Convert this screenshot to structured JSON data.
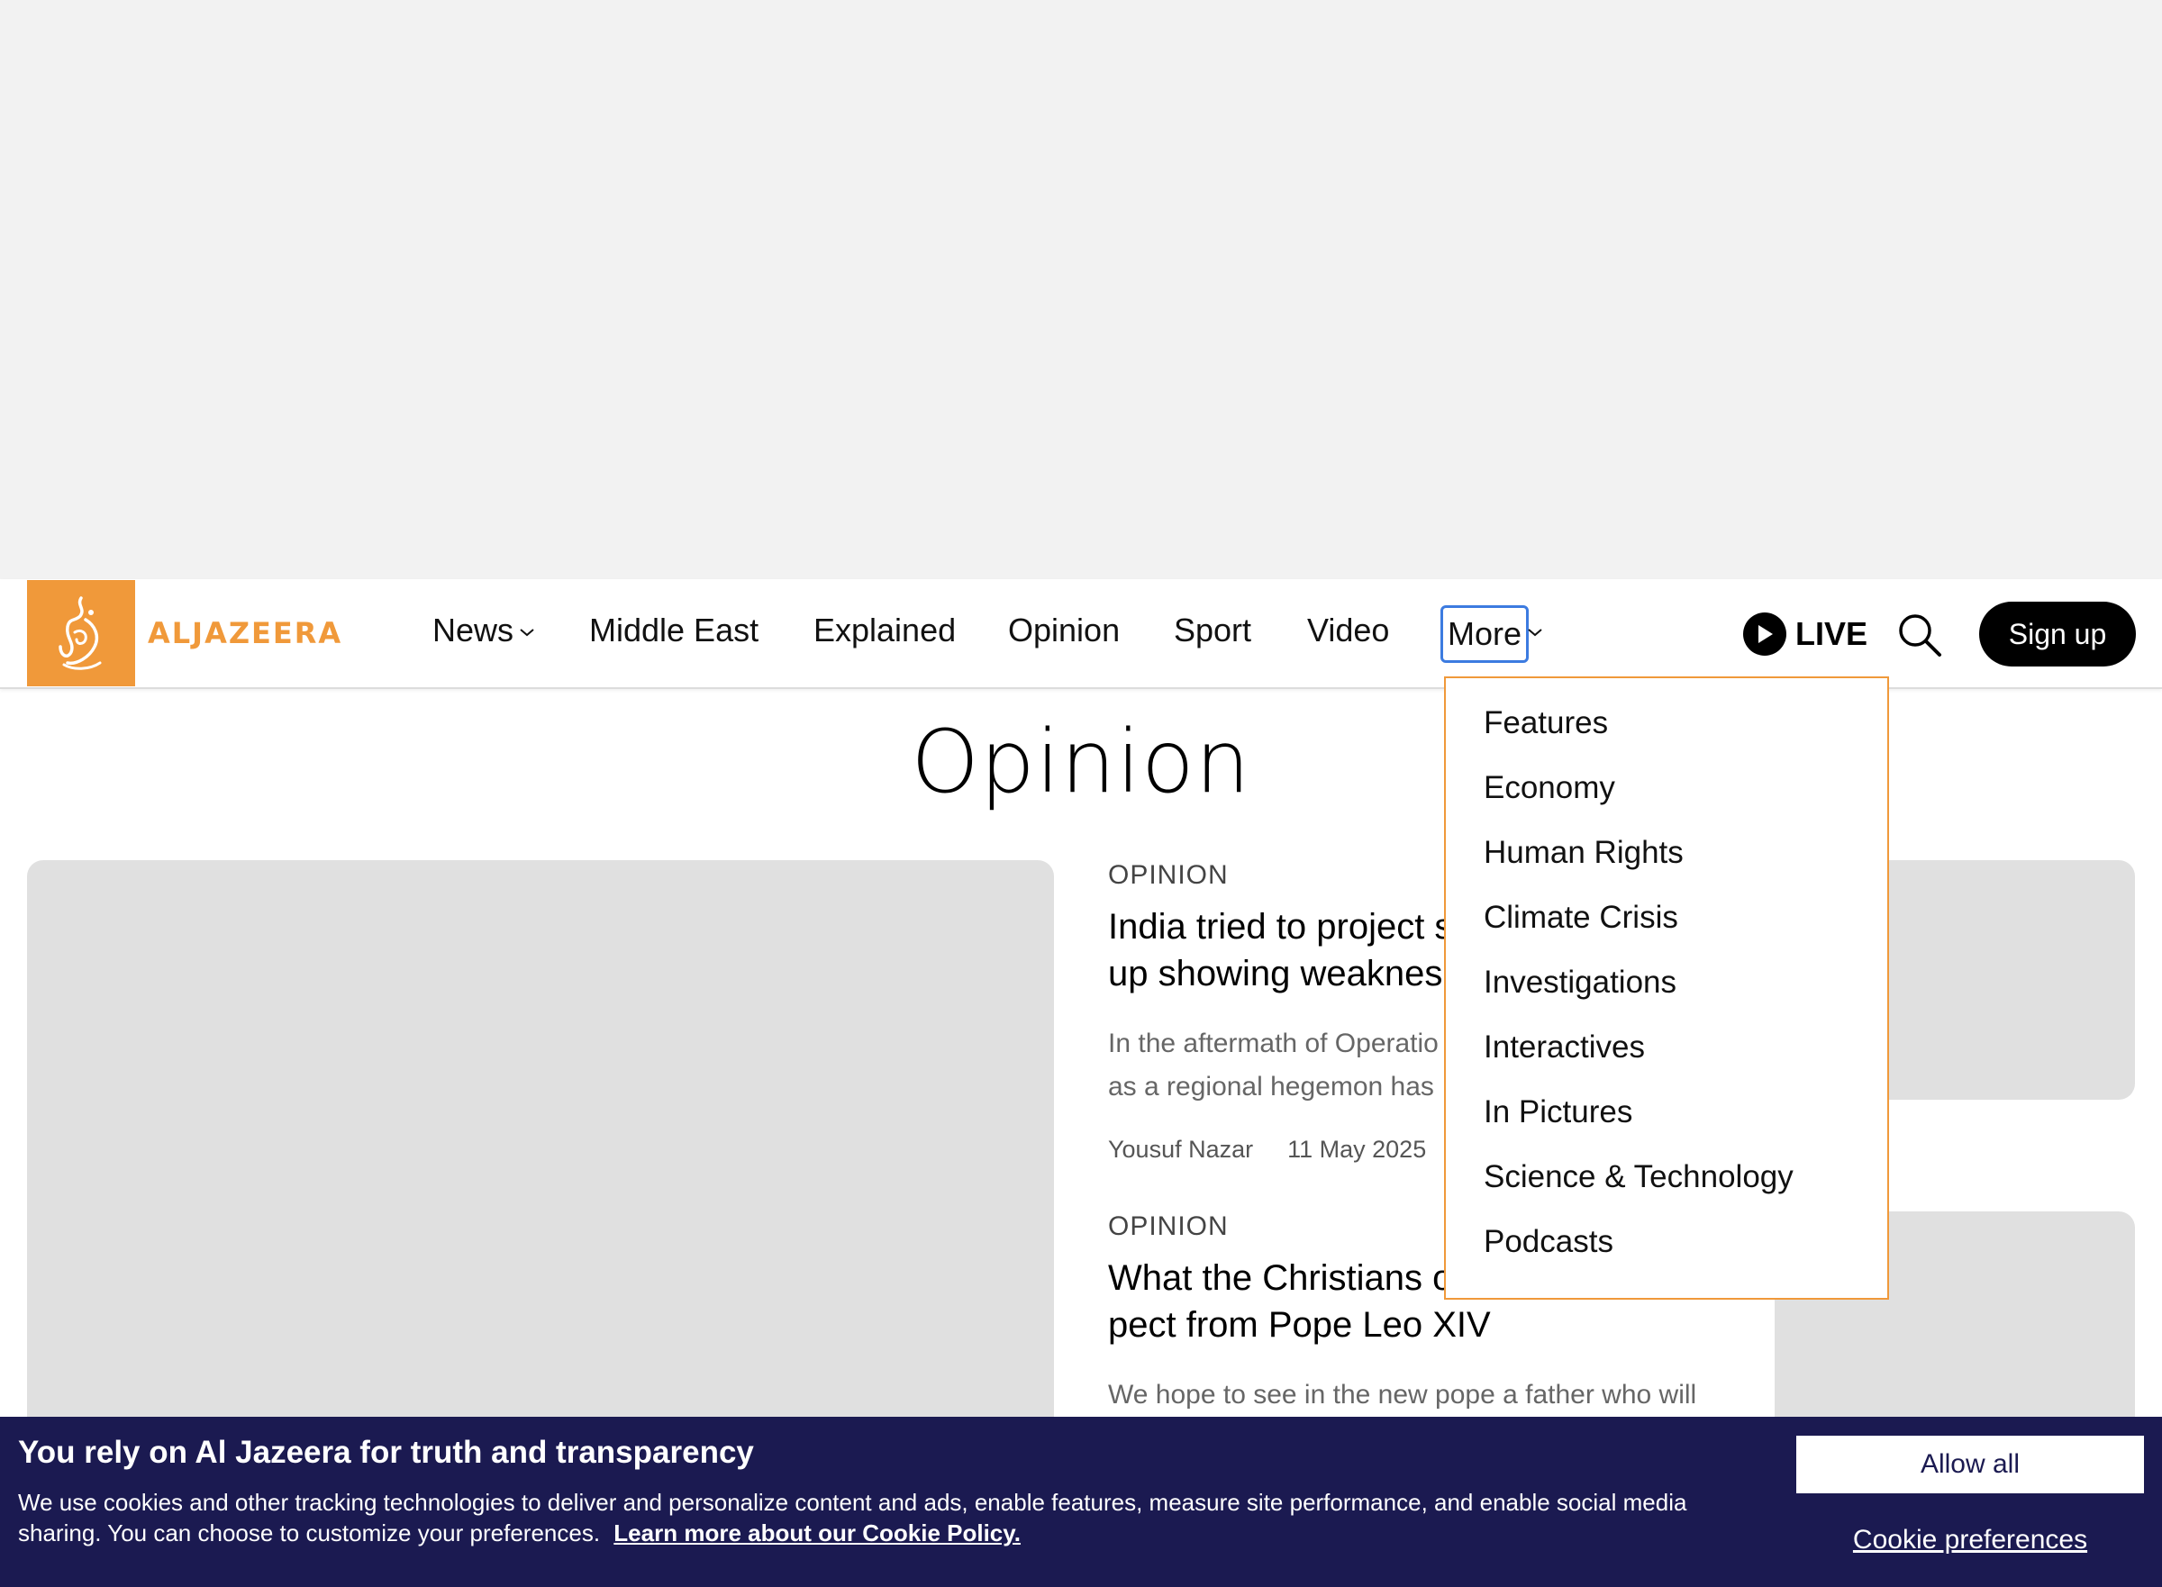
{
  "brand": {
    "name": "ALJAZEERA",
    "accent": "#f0993a"
  },
  "nav": {
    "items": [
      "News",
      "Middle East",
      "Explained",
      "Opinion",
      "Sport",
      "Video",
      "More"
    ],
    "live_label": "LIVE",
    "signup_label": "Sign up",
    "search_icon": "search-icon"
  },
  "more_menu": {
    "items": [
      "Features",
      "Economy",
      "Human Rights",
      "Climate Crisis",
      "Investigations",
      "Interactives",
      "In Pictures",
      "Science & Technology",
      "Podcasts"
    ]
  },
  "page": {
    "title": "Opinion"
  },
  "articles": [
    {
      "kicker": "OPINION",
      "headline": "India tried to project s",
      "headline_line2": "up showing weaknes",
      "summary": "In the aftermath of Operatio",
      "summary_line2": "as a regional hegemon has",
      "author": "Yousuf Nazar",
      "date": "11 May 2025"
    },
    {
      "kicker": "OPINION",
      "headline": "What the Christians o",
      "headline_line2": "pect from Pope Leo XIV",
      "summary": "We hope to see in the new pope a father who will"
    }
  ],
  "cookie_banner": {
    "title": "You rely on Al Jazeera for truth and transparency",
    "text": "We use cookies and other tracking technologies to deliver and personalize content and ads, enable features, measure site performance, and enable social media sharing. You can choose to customize your preferences.",
    "policy_link": "Learn more about our Cookie Policy.",
    "allow_label": "Allow all",
    "preferences_label": "Cookie preferences",
    "background": "#1b1a51"
  }
}
